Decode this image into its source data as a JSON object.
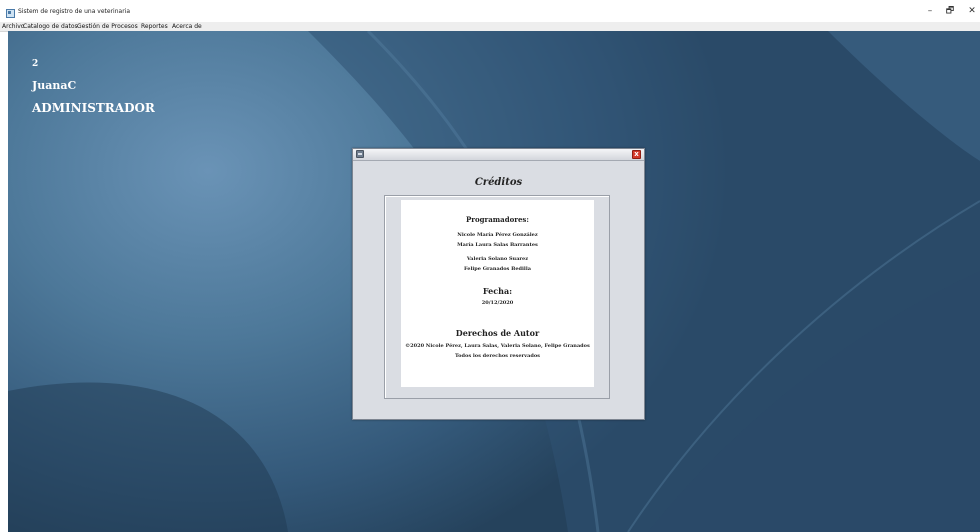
{
  "window": {
    "title": "Sistem de registro de una veterinaria",
    "controls": {
      "minimize": "–",
      "maximize": "🗗",
      "close": "✕"
    }
  },
  "menu": {
    "items": [
      "Archivo",
      "Catalogo de datos",
      "Gestión de Procesos",
      "Reportes",
      "Acerca de"
    ]
  },
  "session": {
    "id": "2",
    "username": "JuanaC",
    "role": "ADMINISTRADOR"
  },
  "dialog": {
    "icon": "frame-menu-icon",
    "close_label": "x",
    "title": "Créditos",
    "programmers_heading": "Programadores:",
    "programmers": [
      "Nicole María Pérez González",
      "María Laura Salas Barrantes",
      "Valeria Solano Suarez",
      "Felipe Granados Bedilla"
    ],
    "date_heading": "Fecha:",
    "date": "20/12/2020",
    "rights_heading": "Derechos de Autor",
    "copyright": "©2020 Nicole Pérez, Laura Salas, Valeria Solano, Felipe Granados",
    "rights_reserved": "Todos los derechos reservados"
  },
  "colors": {
    "desktop": "#34597a",
    "close_button": "#d43a2a"
  }
}
